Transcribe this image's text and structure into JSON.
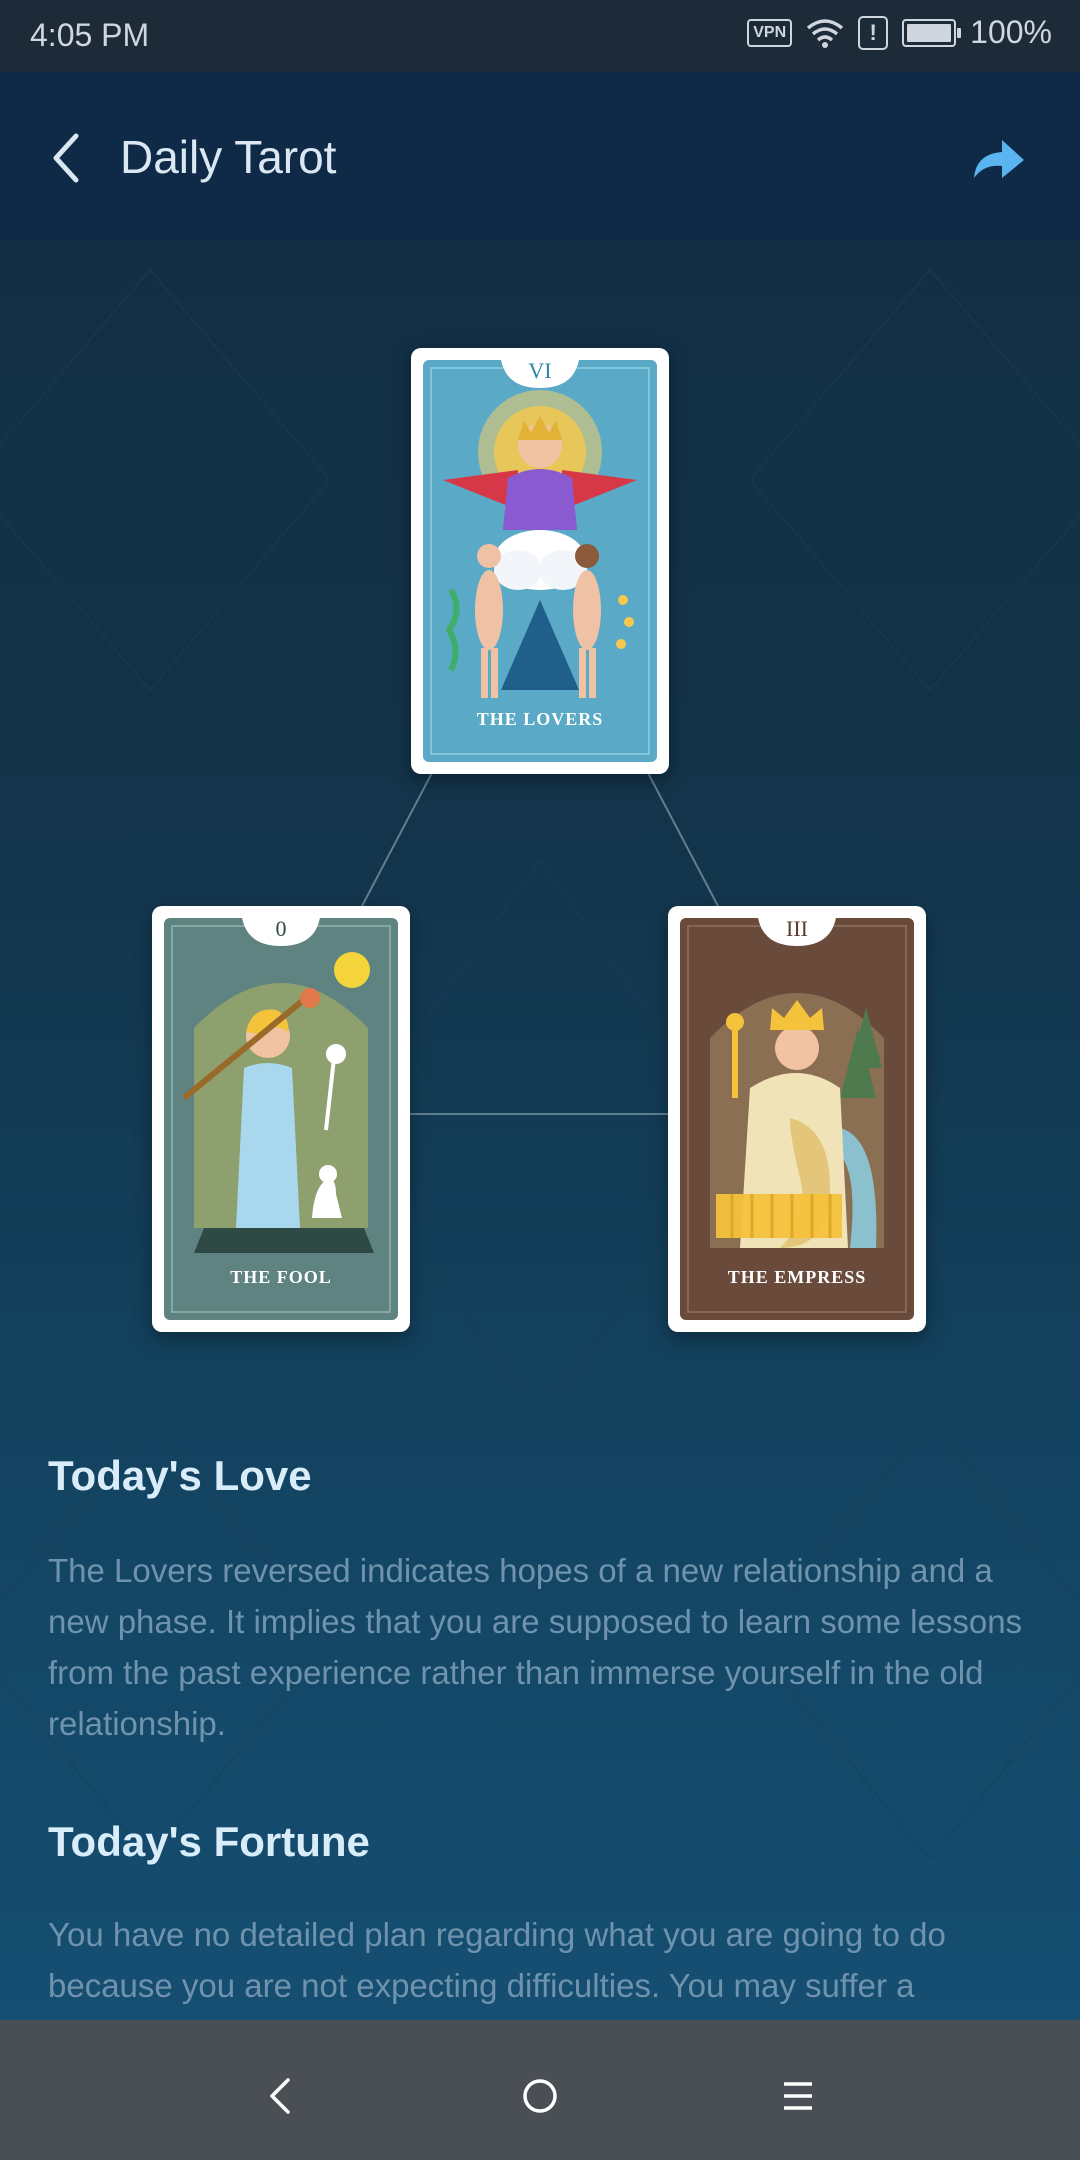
{
  "status_bar": {
    "time": "4:05 PM",
    "vpn": "VPN",
    "battery": "100%"
  },
  "app_bar": {
    "title": "Daily Tarot"
  },
  "cards": [
    {
      "numeral": "VI",
      "name": "THE LOVERS",
      "role": "top"
    },
    {
      "numeral": "0",
      "name": "THE FOOL",
      "role": "left"
    },
    {
      "numeral": "III",
      "name": "THE EMPRESS",
      "role": "right"
    }
  ],
  "sections": [
    {
      "title": "Today's Love",
      "body": "The Lovers reversed indicates hopes of a new relationship and a new phase. It implies that you are supposed to learn some lessons from the past experience rather than immerse yourself in the old relationship."
    },
    {
      "title": "Today's Fortune",
      "body": "You have no detailed plan regarding what you are going to do because you are not expecting difficulties. You may suffer a"
    }
  ],
  "icons": {
    "back": "back-arrow-icon",
    "share": "share-icon",
    "nav_back": "nav-back-icon",
    "nav_home": "nav-home-icon",
    "nav_menu": "nav-menu-icon"
  },
  "colors": {
    "app_bar": "#0e2a47",
    "title_text": "#dbe7f3",
    "section_title": "#d9ecfa",
    "section_body": "#6f93ad",
    "share_accent": "#5ab4f0"
  }
}
